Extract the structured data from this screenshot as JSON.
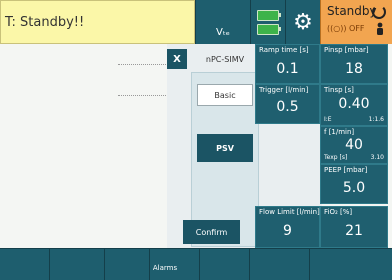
{
  "header": {
    "status_text": "T: Standby!!",
    "vte_label": "Vₜₑ",
    "standby_label": "Standby",
    "off_label": "OFF"
  },
  "dialog": {
    "close_label": "X",
    "mode_title": "nPC-SIMV",
    "basic_label": "Basic",
    "psv_label": "PSV",
    "confirm_label": "Confirm"
  },
  "params": {
    "ramp_time": {
      "label": "Ramp time [s]",
      "value": "0.1"
    },
    "pinsp": {
      "label": "Pinsp [mbar]",
      "value": "18"
    },
    "trigger": {
      "label": "Trigger [l/min]",
      "value": "0.5"
    },
    "tinsp": {
      "label": "Tinsp [s]",
      "value": "0.40",
      "ie_label": "I:E",
      "ie_value": "1:1.6"
    },
    "freq": {
      "label": "f [1/min]",
      "value": "40",
      "texp_label": "Texp [s]",
      "texp_value": "3.10"
    },
    "peep": {
      "label": "PEEP [mbar]",
      "value": "5.0"
    },
    "flow_limit": {
      "label": "Flow Limit [l/min]",
      "value": "9"
    },
    "fio2": {
      "label": "FiO₂ [%]",
      "value": "21"
    }
  },
  "footer": {
    "alarms_label": "Alarms"
  },
  "colors": {
    "header_status_bg": "#fbf7a8",
    "tile_bg": "#1f5f6f",
    "standby_bg": "#f2a550",
    "battery_green": "#3db34a"
  },
  "icons": [
    "settings-gears-icon",
    "battery-icon",
    "power-icon",
    "person-icon"
  ]
}
